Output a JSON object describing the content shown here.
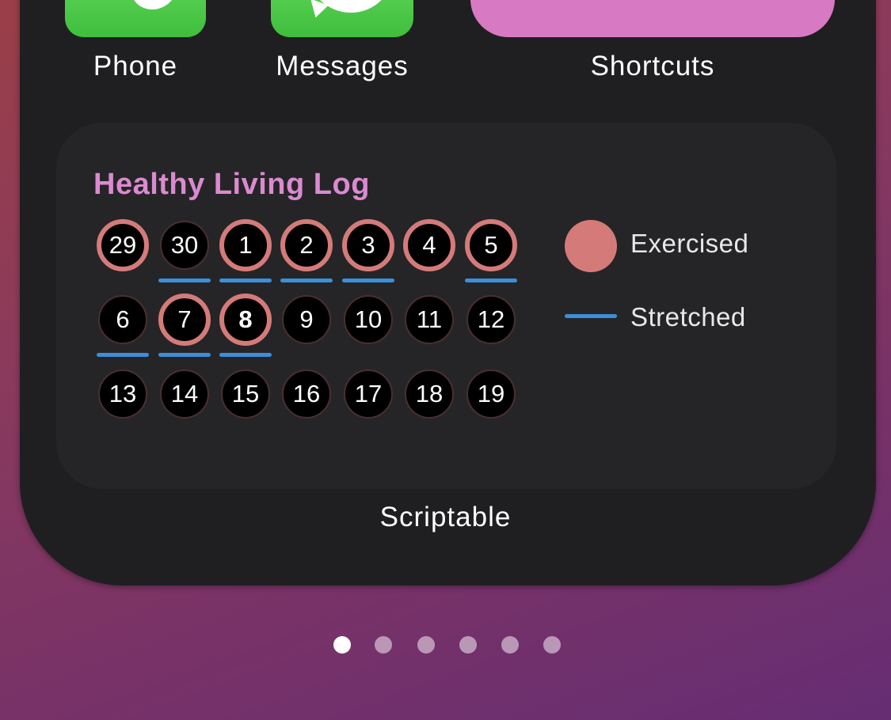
{
  "dock_apps": [
    {
      "label": "Phone",
      "icon": "phone-icon"
    },
    {
      "label": "Messages",
      "icon": "messages-icon"
    },
    {
      "label": "Shortcuts",
      "icon": "shortcuts-icon"
    }
  ],
  "widget": {
    "title": "Healthy Living Log",
    "app_label": "Scriptable",
    "days": [
      {
        "label": "29",
        "exercised": true,
        "stretched": false
      },
      {
        "label": "30",
        "exercised": false,
        "stretched": true
      },
      {
        "label": "1",
        "exercised": true,
        "stretched": true
      },
      {
        "label": "2",
        "exercised": true,
        "stretched": true
      },
      {
        "label": "3",
        "exercised": true,
        "stretched": true
      },
      {
        "label": "4",
        "exercised": true,
        "stretched": false
      },
      {
        "label": "5",
        "exercised": true,
        "stretched": true
      },
      {
        "label": "6",
        "exercised": false,
        "stretched": true
      },
      {
        "label": "7",
        "exercised": true,
        "stretched": true
      },
      {
        "label": "8",
        "exercised": true,
        "stretched": true,
        "today": true
      },
      {
        "label": "9",
        "exercised": false,
        "stretched": false
      },
      {
        "label": "10",
        "exercised": false,
        "stretched": false
      },
      {
        "label": "11",
        "exercised": false,
        "stretched": false
      },
      {
        "label": "12",
        "exercised": false,
        "stretched": false
      },
      {
        "label": "13",
        "exercised": false,
        "stretched": false
      },
      {
        "label": "14",
        "exercised": false,
        "stretched": false
      },
      {
        "label": "15",
        "exercised": false,
        "stretched": false
      },
      {
        "label": "16",
        "exercised": false,
        "stretched": false
      },
      {
        "label": "17",
        "exercised": false,
        "stretched": false
      },
      {
        "label": "18",
        "exercised": false,
        "stretched": false
      },
      {
        "label": "19",
        "exercised": false,
        "stretched": false
      }
    ],
    "legend": [
      {
        "label": "Exercised",
        "color": "#d47b79"
      },
      {
        "label": "Stretched",
        "color": "#3b8fdb"
      }
    ]
  },
  "page_indicator": {
    "count": 6,
    "active": 1
  },
  "colors": {
    "title": "#db8ad0",
    "exercised": "#d47b79",
    "stretched": "#3b8fdb"
  }
}
